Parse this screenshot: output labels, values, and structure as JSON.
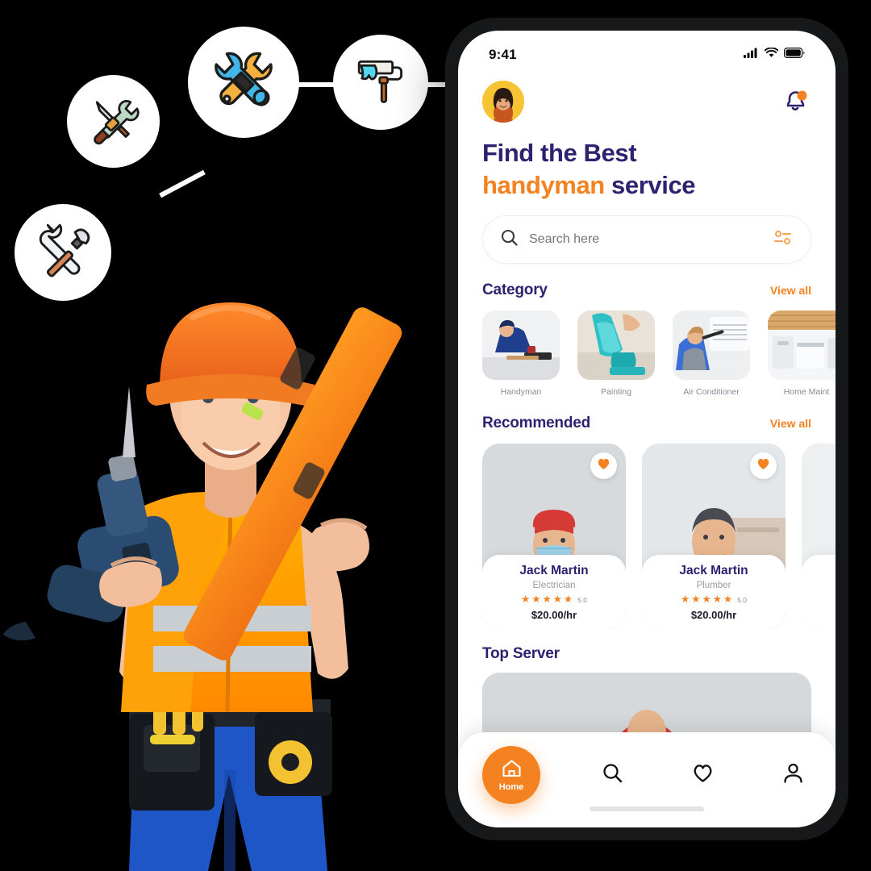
{
  "statusbar": {
    "time": "9:41",
    "icons": [
      "signal-icon",
      "wifi-icon",
      "battery-icon"
    ]
  },
  "topbar": {
    "avatar_name": "user-avatar",
    "notification_icon": "bell-icon",
    "notification_badge": true
  },
  "headline": {
    "line1": "Find the Best",
    "line2_accent": "handyman",
    "line2_rest": " service",
    "color_primary": "#2D2170",
    "color_accent": "#F58220"
  },
  "search": {
    "placeholder": "Search here",
    "value": "",
    "search_icon": "search-icon",
    "filter_icon": "filter-icon"
  },
  "category": {
    "title": "Category",
    "view_all": "View all",
    "items": [
      {
        "label": "Handyman",
        "image": "handyman-photo"
      },
      {
        "label": "Painting",
        "image": "painting-photo"
      },
      {
        "label": "Air Conditioner",
        "image": "air-conditioner-photo"
      },
      {
        "label": "Home Maint",
        "image": "home-maintenance-photo"
      }
    ]
  },
  "recommended": {
    "title": "Recommended",
    "view_all": "View all",
    "items": [
      {
        "name": "Jack Martin",
        "role": "Electrician",
        "rating": "5.0",
        "stars": 5,
        "price": "$20.00/hr",
        "favorite": true
      },
      {
        "name": "Jack Martin",
        "role": "Plumber",
        "rating": "5.0",
        "stars": 5,
        "price": "$20.00/hr",
        "favorite": true
      },
      {
        "name": "",
        "role": "",
        "rating": "",
        "stars": 0,
        "price": "",
        "favorite": false
      }
    ]
  },
  "top_server": {
    "title": "Top Server"
  },
  "bottom_nav": {
    "items": [
      {
        "label": "Home",
        "icon": "home-icon",
        "active": true
      },
      {
        "label": "",
        "icon": "search-icon",
        "active": false
      },
      {
        "label": "",
        "icon": "heart-icon",
        "active": false
      },
      {
        "label": "",
        "icon": "profile-icon",
        "active": false
      }
    ],
    "active_color": "#F58220"
  },
  "decor": {
    "bubbles": [
      {
        "name": "screwdriver-wrench-icon"
      },
      {
        "name": "wrench-spanner-icon"
      },
      {
        "name": "paint-roller-icon"
      },
      {
        "name": "hammer-wrench-icon"
      }
    ],
    "hero": "handyman-worker-photo"
  }
}
